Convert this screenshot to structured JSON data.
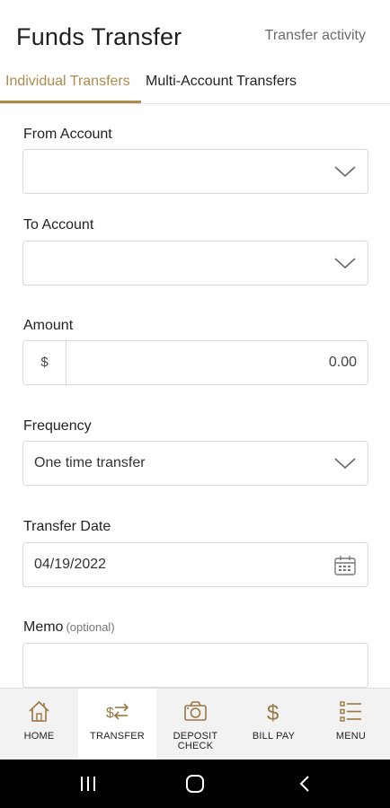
{
  "header": {
    "title": "Funds Transfer",
    "activity_link": "Transfer activity"
  },
  "tabs": [
    {
      "label": "Individual Transfers",
      "active": true
    },
    {
      "label": "Multi-Account Transfers",
      "active": false
    }
  ],
  "form": {
    "from_account": {
      "label": "From Account",
      "value": ""
    },
    "to_account": {
      "label": "To Account",
      "value": ""
    },
    "amount": {
      "label": "Amount",
      "currency": "$",
      "value": "0.00"
    },
    "frequency": {
      "label": "Frequency",
      "value": "One time transfer"
    },
    "transfer_date": {
      "label": "Transfer Date",
      "value": "04/19/2022"
    },
    "memo": {
      "label": "Memo",
      "optional": "(optional)",
      "value": ""
    }
  },
  "bottom_nav": [
    {
      "label": "HOME",
      "icon": "home-icon",
      "active": false
    },
    {
      "label": "TRANSFER",
      "icon": "transfer-arrows-icon",
      "active": true
    },
    {
      "label_line1": "DEPOSIT",
      "label_line2": "CHECK",
      "icon": "camera-icon",
      "active": false
    },
    {
      "label": "BILL PAY",
      "icon": "dollar-icon",
      "active": false
    },
    {
      "label": "MENU",
      "icon": "menu-list-icon",
      "active": false
    }
  ],
  "colors": {
    "accent": "#b08a4a",
    "icon": "#9a7640",
    "border": "#d9d9d9",
    "nav_background": "#f2f2f2",
    "system_bar": "#000000"
  }
}
